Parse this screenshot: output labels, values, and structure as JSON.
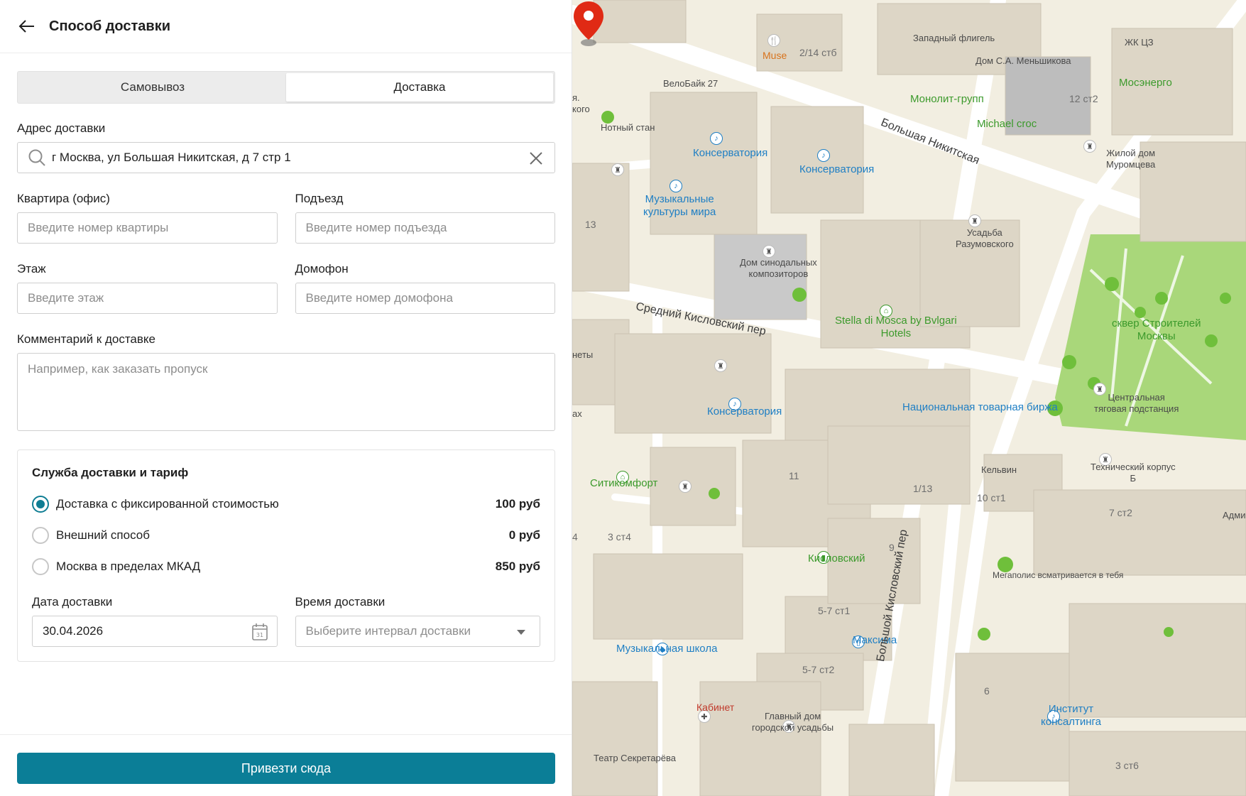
{
  "header": {
    "title": "Способ доставки"
  },
  "tabs": [
    {
      "label": "Самовывоз",
      "active": false
    },
    {
      "label": "Доставка",
      "active": true
    }
  ],
  "address": {
    "label": "Адрес доставки",
    "value": "г Москва, ул Большая Никитская, д 7 стр 1"
  },
  "apartment": {
    "label": "Квартира (офис)",
    "placeholder": "Введите номер квартиры"
  },
  "entrance": {
    "label": "Подъезд",
    "placeholder": "Введите номер подъезда"
  },
  "floor": {
    "label": "Этаж",
    "placeholder": "Введите этаж"
  },
  "intercom": {
    "label": "Домофон",
    "placeholder": "Введите номер домофона"
  },
  "comment": {
    "label": "Комментарий к доставке",
    "placeholder": "Например, как заказать пропуск"
  },
  "service": {
    "title": "Служба доставки и тариф",
    "options": [
      {
        "label": "Доставка с фиксированной стоимостью",
        "price": "100 руб",
        "selected": true
      },
      {
        "label": "Внешний способ",
        "price": "0 руб",
        "selected": false
      },
      {
        "label": "Москва в пределах МКАД",
        "price": "850 руб",
        "selected": false
      }
    ],
    "date": {
      "label": "Дата доставки",
      "value": "30.04.2026"
    },
    "time": {
      "label": "Время доставки",
      "placeholder": "Выберите интервал доставки"
    }
  },
  "footer": {
    "button_label": "Привезти сюда"
  },
  "colors": {
    "accent": "#0b7e97",
    "map_bg": "#f2eee1",
    "pin": "#e02a14",
    "park": "#a9d77a"
  },
  "map": {
    "labels": {
      "muse": "Muse",
      "n214": "2/14 стб",
      "zap_fligel": "Западный флигель",
      "dom_menshikova": "Дом С.А. Меньшикова",
      "zhk": "ЖК ЦЗ",
      "mosenergo": "Мосэнерго",
      "velobike": "ВелоБайк 27",
      "monolit": "Монолит-групп",
      "n12c2": "12 ст2",
      "michael": "Michael croc",
      "notny": "Нотный стан",
      "kons1": "Консерватория",
      "kons2": "Консерватория",
      "kons3": "Консерватория",
      "b_nikitskaya": "Большая Никитская",
      "zhiloy": "Жилой дом\nМуромцева",
      "muz_kult": "Музыкальные\nкультуры мира",
      "n13": "13",
      "usadba": "Усадьба\nРазумовского",
      "dom_sinod": "Дом синодальных\nкомпозиторов",
      "skver": "сквер Строителей\nМосквы",
      "sred_kisl": "Средний Кисловский пер",
      "stella": "Stella di Mosca by Bvlgari\nHotels",
      "tsentr": "Центральная\nтяговая подстанция",
      "nats": "Национальная товарная биржа",
      "n11": "11",
      "sitikomfort": "Ситикомфорт",
      "n113": "1/13",
      "kelvi": "Кельвин",
      "n10c1": "10 ст1",
      "tech": "Технический корпус\nБ",
      "n7c2": "7 ст2",
      "admin": "Админ",
      "n3c4": "3 ст4",
      "kislovsky": "Кисловский",
      "n9": "9",
      "megapolis": "Мегаполис всматривается в тебя",
      "n57c1": "5-7 ст1",
      "muz_shkola": "Музыкальная школа",
      "maksima": "Максима",
      "b_kisl": "Большой Кисловский пер",
      "n57c2": "5-7 ст2",
      "n6": "6",
      "institut": "Институт\nконсалтинга",
      "kabinet": "Кабинет",
      "glavny": "Главный дом\nгородской усадьбы",
      "teatr": "Театр Секретарёва",
      "n3c6": "3 ст6",
      "yako": "я.\nкого",
      "nety": "неты",
      "ax": "ах",
      "n4": "4"
    }
  }
}
